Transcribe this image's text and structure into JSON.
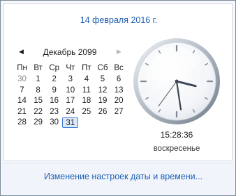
{
  "header": {
    "date_link": "14 февраля 2016 г."
  },
  "calendar": {
    "prev_arrow": "◀",
    "next_arrow": "▶",
    "month_label": "Декабрь 2099",
    "weekdays": [
      "Пн",
      "Вт",
      "Ср",
      "Чт",
      "Пт",
      "Сб",
      "Вс"
    ],
    "weeks": [
      [
        "30",
        "1",
        "2",
        "3",
        "4",
        "5",
        "6"
      ],
      [
        "7",
        "8",
        "9",
        "10",
        "11",
        "12",
        "13"
      ],
      [
        "14",
        "15",
        "16",
        "17",
        "18",
        "19",
        "20"
      ],
      [
        "21",
        "22",
        "23",
        "24",
        "25",
        "26",
        "27"
      ],
      [
        "28",
        "29",
        "30",
        "31"
      ]
    ],
    "other_month_days": [
      [
        0,
        0
      ]
    ],
    "selected_day": [
      4,
      3
    ]
  },
  "clock": {
    "hours": 15,
    "minutes": 28,
    "seconds": 36,
    "time_text": "15:28:36",
    "weekday_text": "воскресенье"
  },
  "footer": {
    "change_settings_link": "Изменение настроек даты и времени..."
  },
  "colors": {
    "link": "#1e5fb3",
    "selection_border": "#3d7bd0",
    "selection_fill": "#dce9fb"
  }
}
